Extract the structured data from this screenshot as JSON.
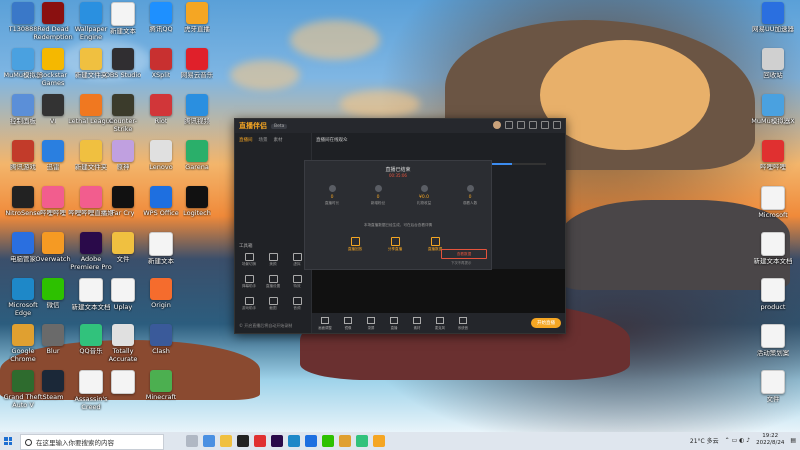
{
  "desktop": {
    "left_col1": [
      {
        "label": "T130888",
        "icon": "computer-icon",
        "color": "#3a78c8"
      },
      {
        "label": "MuMu模拟器",
        "icon": "mumu-icon",
        "color": "#4aa1e0"
      },
      {
        "label": "控制面板",
        "icon": "control-panel-icon",
        "color": "#5b8fd8"
      },
      {
        "label": "腾讯游戏",
        "icon": "game-icon",
        "color": "#c23b2a"
      },
      {
        "label": "NitroSense",
        "icon": "nitrosense-icon",
        "color": "#222222"
      },
      {
        "label": "电脑管家",
        "icon": "shield-icon",
        "color": "#2a6fe0"
      },
      {
        "label": "Microsoft Edge",
        "icon": "edge-icon",
        "color": "#1e88c8"
      },
      {
        "label": "Google Chrome",
        "icon": "chrome-icon",
        "color": "#e0a030"
      },
      {
        "label": "Grand Theft Auto V",
        "icon": "gta-icon",
        "color": "#2e6b2e"
      }
    ],
    "left_col2": [
      {
        "label": "Red Dead Redemption",
        "icon": "rdr-icon",
        "color": "#8a1010"
      },
      {
        "label": "Rockstar Games",
        "icon": "rockstar-icon",
        "color": "#f5b800"
      },
      {
        "label": "VI",
        "icon": "vi-icon",
        "color": "#333333"
      },
      {
        "label": "迅雷",
        "icon": "thunder-icon",
        "color": "#2a7fe0"
      },
      {
        "label": "哔哩哔哩",
        "icon": "bilibili-icon",
        "color": "#f25d8e"
      },
      {
        "label": "Overwatch",
        "icon": "overwatch-icon",
        "color": "#f59a23"
      },
      {
        "label": "微信",
        "icon": "wechat-icon",
        "color": "#2dc100"
      },
      {
        "label": "Blur",
        "icon": "blur-icon",
        "color": "#6a6a6a"
      },
      {
        "label": "Steam",
        "icon": "steam-icon",
        "color": "#1b2838"
      }
    ],
    "left_col3": [
      {
        "label": "Wallpaper Engine",
        "icon": "wallpaper-icon",
        "color": "#2a90e0"
      },
      {
        "label": "新建文件夹",
        "icon": "folder-icon",
        "color": "#f0c040"
      },
      {
        "label": "Lethal League",
        "icon": "lethal-icon",
        "color": "#f07820"
      },
      {
        "label": "新建文件夹",
        "icon": "folder-icon",
        "color": "#f0c040"
      },
      {
        "label": "哔哩哔哩直播姬",
        "icon": "bilibili-live-icon",
        "color": "#f25d8e"
      },
      {
        "label": "Adobe Premiere Pro",
        "icon": "premiere-icon",
        "color": "#2a0a4a"
      },
      {
        "label": "新建文本文档",
        "icon": "doc-icon",
        "color": "#f4f4f4"
      },
      {
        "label": "QQ音乐",
        "icon": "qq-music-icon",
        "color": "#31c27c"
      },
      {
        "label": "Assassin's Creed",
        "icon": "doc-icon",
        "color": "#f4f4f4"
      }
    ],
    "left_col4": [
      {
        "label": "新建文本",
        "icon": "doc-icon",
        "color": "#f4f4f4"
      },
      {
        "label": "OBS Studio",
        "icon": "obs-icon",
        "color": "#302e31"
      },
      {
        "label": "Counter-Strike",
        "icon": "cs-icon",
        "color": "#3b3b2b"
      },
      {
        "label": "原神",
        "icon": "genshin-icon",
        "color": "#c0a0e0"
      },
      {
        "label": "Far Cry",
        "icon": "farcry-icon",
        "color": "#111111"
      },
      {
        "label": "文件",
        "icon": "folder-icon",
        "color": "#f0c040"
      },
      {
        "label": "Uplay",
        "icon": "doc-icon",
        "color": "#f4f4f4"
      },
      {
        "label": "Totally Accurate",
        "icon": "tabs-icon",
        "color": "#e0e0e0"
      },
      {
        "label": "",
        "icon": "doc-icon",
        "color": "#f4f4f4"
      }
    ],
    "left_col5": [
      {
        "label": "腾讯QQ",
        "icon": "paper-plane-icon",
        "color": "#1e90ff"
      },
      {
        "label": "XSplit",
        "icon": "xsplit-icon",
        "color": "#c83030"
      },
      {
        "label": "Riot",
        "icon": "riot-icon",
        "color": "#d13639"
      },
      {
        "label": "Lenovo",
        "icon": "lenovo-icon",
        "color": "#e0e0e0"
      },
      {
        "label": "WPS Office",
        "icon": "wps-icon",
        "color": "#1e6fe0"
      },
      {
        "label": "新建文本",
        "icon": "doc-icon",
        "color": "#f4f4f4"
      },
      {
        "label": "Origin",
        "icon": "origin-icon",
        "color": "#f56c2d"
      },
      {
        "label": "Clash",
        "icon": "clash-icon",
        "color": "#3a5a9a"
      },
      {
        "label": "Minecraft",
        "icon": "minecraft-icon",
        "color": "#4caf50"
      }
    ],
    "left_col6": [
      {
        "label": "虎牙直播",
        "icon": "huya-icon",
        "color": "#f5a623"
      },
      {
        "label": "网易云音乐",
        "icon": "netease-icon",
        "color": "#e0202a"
      },
      {
        "label": "腾讯视频",
        "icon": "tencent-video-icon",
        "color": "#2a8fe0"
      },
      {
        "label": "Garena",
        "icon": "garena-icon",
        "color": "#2aaf6a"
      },
      {
        "label": "Logitech",
        "icon": "logitech-icon",
        "color": "#111111"
      }
    ],
    "right_col": [
      {
        "label": "网易UU加速器",
        "icon": "uu-icon",
        "color": "#2a6fe0"
      },
      {
        "label": "回收站",
        "icon": "recycle-bin-icon",
        "color": "#d0d0d0"
      },
      {
        "label": "MuMu模拟器X",
        "icon": "mumu-icon",
        "color": "#4aa1e0"
      },
      {
        "label": "哔哩哔哩",
        "icon": "bilibili-icon",
        "color": "#e03030"
      },
      {
        "label": "Microsoft",
        "icon": "doc-icon",
        "color": "#f4f4f4"
      },
      {
        "label": "新建文本文档",
        "icon": "doc-icon",
        "color": "#f4f4f4"
      },
      {
        "label": "product",
        "icon": "doc-icon",
        "color": "#f4f4f4"
      },
      {
        "label": "活动策划案",
        "icon": "doc-icon",
        "color": "#f4f4f4"
      },
      {
        "label": "文件",
        "icon": "doc-icon",
        "color": "#f4f4f4"
      }
    ]
  },
  "app": {
    "logo": "直播伴侣",
    "tag": "Beta",
    "left_tabs": [
      "直播间",
      "场景",
      "素材"
    ],
    "tools_title": "工具箱",
    "tools": [
      "场景切换",
      "美颜",
      "虚拟",
      "弹幕助手",
      "直播设置",
      "特效",
      "游戏助手",
      "截图",
      "音频"
    ],
    "footer": "© 开启直播后将自动开始录制",
    "top_info": "直播间在线观众",
    "progress": 0.85,
    "bottom_items": [
      "画面调整",
      "镜像",
      "录屏",
      "直播",
      "素材",
      "麦克风",
      "系统音"
    ],
    "go_live": "开始直播"
  },
  "popup": {
    "title": "直播已结束",
    "subtitle": "00:35:06",
    "stats": [
      {
        "value": "0",
        "label": "直播时长"
      },
      {
        "value": "0",
        "label": "新增粉丝"
      },
      {
        "value": "¥0.0",
        "label": "礼物收益"
      },
      {
        "value": "0",
        "label": "观看人数"
      }
    ],
    "note": "本场直播数据已经生成，可在后台查看详情",
    "actions": [
      "直播回放",
      "分享直播",
      "直播数据"
    ],
    "button": "查看数据",
    "foot": "下次不再提示"
  },
  "taskbar": {
    "search_placeholder": "在这里输入你要搜索的内容",
    "weather": "21°C 多云",
    "time": "19:22",
    "date": "2022/8/24"
  }
}
